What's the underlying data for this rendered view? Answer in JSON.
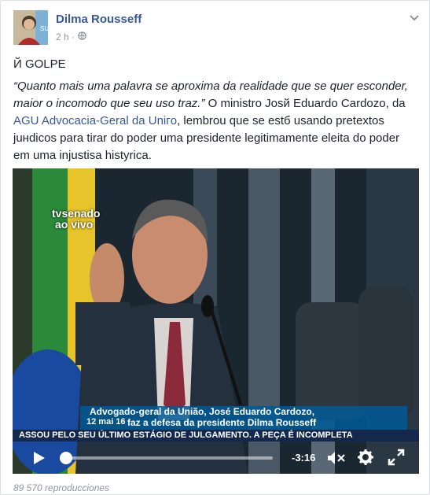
{
  "post": {
    "author": "Dilma Rousseff",
    "time": "2 h ·",
    "title": "Й GOLPE",
    "quote": "“Quanto mais uma palavra se aproxima da realidade que se quer esconder, maior o incomodo que seu uso traz.”",
    "body_1": " O ministro Josй Eduardo Cardozo, da ",
    "link": "AGU Advocacia-Geral da Uniгo",
    "body_2": ", lembrou que se estб usando pretextos juнdicos para tirar do poder uma presidente legitimamente eleita do poder em uma injustisa histуrica.",
    "views": "89  570 reproducciones"
  },
  "video": {
    "logo_line1": "tvsenado",
    "logo_line2": "ao vivo",
    "caption_line1": "Advogado-geral da União, José Eduardo Cardozo,",
    "caption_line2": "faz a defesa da presidente Dilma Rousseff",
    "caption_date": "12 mai 16",
    "ticker": "ASSOU PELO SEU ÚLTIMO ESTÁGIO DE JULGAMENTO. A PEÇA É INCOMPLETA",
    "time_remaining": "-3:16",
    "progress": 0.0
  },
  "icons": {
    "globe": "globe-icon",
    "chevron": "chevron-down-icon",
    "play": "play-icon",
    "mute": "mute-icon",
    "settings": "gear-icon",
    "fullscreen": "fullscreen-icon"
  },
  "colors": {
    "link": "#365899",
    "secondary_text": "#90949c"
  }
}
